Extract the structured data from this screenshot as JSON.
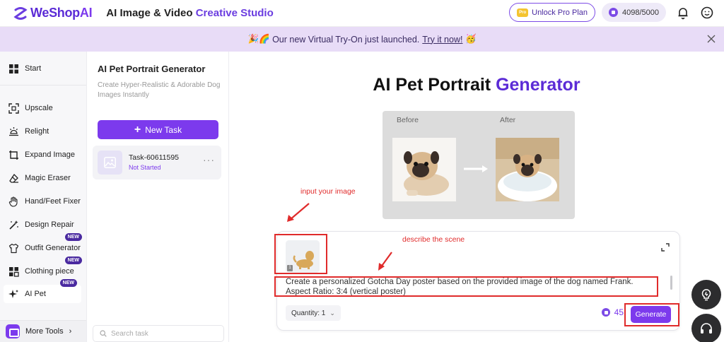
{
  "header": {
    "logo_text_main": "WeShop",
    "logo_text_ai": "AI",
    "studio_title_plain": "AI Image & Video",
    "studio_title_accent": "Creative Studio",
    "pro_chip": "Pro",
    "unlock_label": "Unlock Pro Plan",
    "credits": "4098/5000"
  },
  "banner": {
    "emoji_left": "🎉🌈",
    "text": "Our new Virtual Try-On just launched.",
    "link": "Try it now!",
    "emoji_right": "🥳"
  },
  "sidebar": {
    "start": "Start",
    "items": [
      {
        "label": "Upscale"
      },
      {
        "label": "Relight"
      },
      {
        "label": "Expand Image"
      },
      {
        "label": "Magic Eraser"
      },
      {
        "label": "Hand/Feet Fixer"
      },
      {
        "label": "Design Repair"
      },
      {
        "label": "Outfit Generator",
        "badge": "NEW"
      },
      {
        "label": "Clothing piece",
        "badge": "NEW"
      },
      {
        "label": "AI Pet",
        "badge": "NEW"
      }
    ],
    "more_tools": "More Tools"
  },
  "task_panel": {
    "title": "AI Pet Portrait Generator",
    "subtitle": "Create Hyper-Realistic & Adorable Dog Images Instantly",
    "new_task": "New Task",
    "task": {
      "name": "Task-60611595",
      "status": "Not Started"
    },
    "search_placeholder": "Search task"
  },
  "main": {
    "title_plain": "AI Pet Portrait",
    "title_accent": "Generator",
    "before_label": "Before",
    "after_label": "After",
    "prompt_line1": "Create a personalized Gotcha Day poster based on the provided image of the dog named Frank.",
    "prompt_line2": "Aspect Ratio: 3:4 (vertical poster)",
    "thumb_badge": "1",
    "quantity_label": "Quantity: 1",
    "cost": "45",
    "generate": "Generate"
  },
  "annotations": {
    "input_image": "input your image",
    "describe_scene": "describe the scene"
  },
  "colors": {
    "accent": "#7c3aed",
    "banner_bg": "#e8dcf7",
    "annotation": "#e02b2b"
  }
}
